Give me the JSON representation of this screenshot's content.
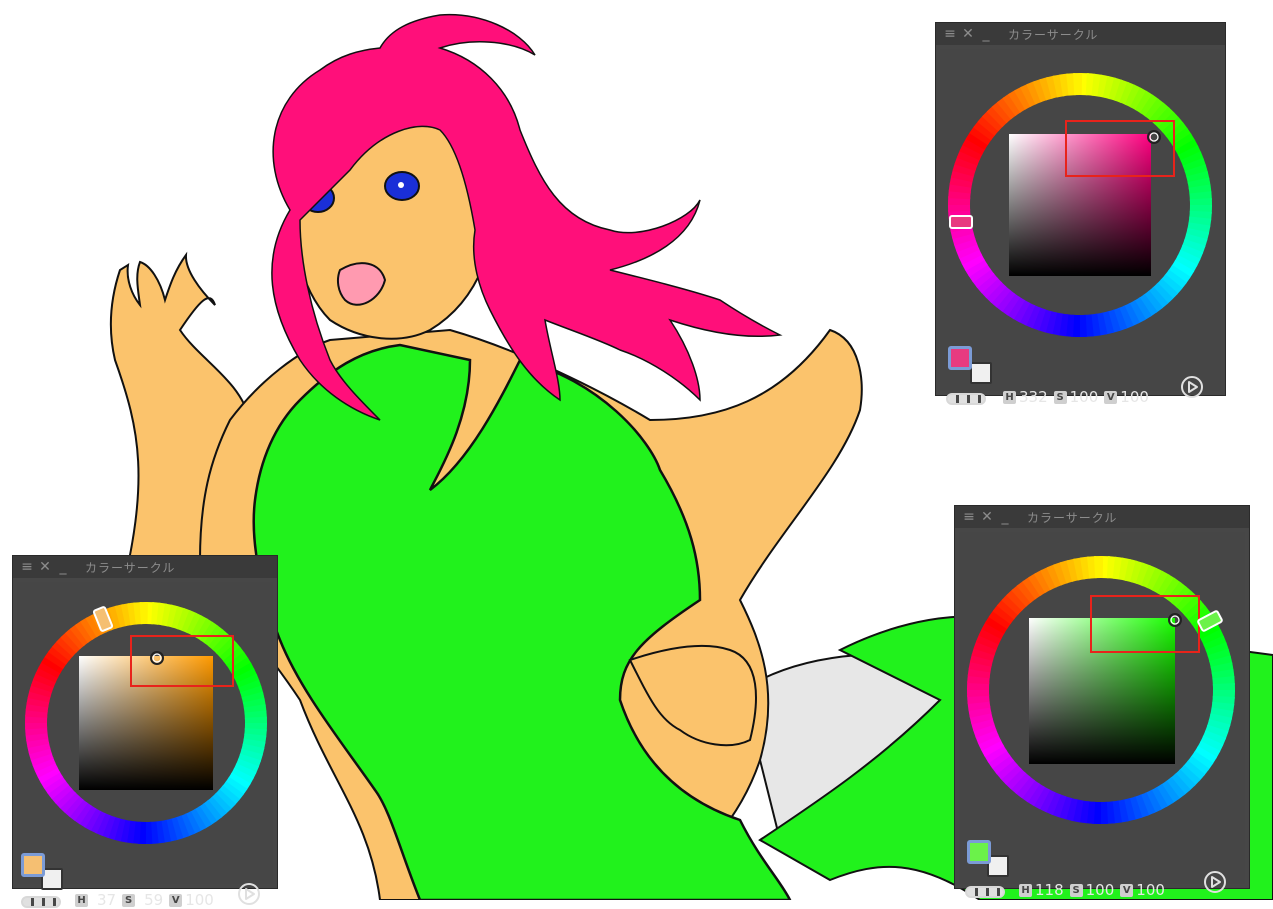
{
  "panels": [
    {
      "id": "top-right",
      "title": "カラーサークル",
      "hsv": {
        "h_label": "H",
        "h": "332",
        "s_label": "S",
        "s": "100",
        "v_label": "V",
        "v": "100"
      },
      "main_color": "#e83a80",
      "hue_marker_color": "#e83a80"
    },
    {
      "id": "bottom-left",
      "title": "カラーサークル",
      "hsv": {
        "h_label": "H",
        "h": "37",
        "s_label": "S",
        "s": "59",
        "v_label": "V",
        "v": "100"
      },
      "main_color": "#f5bf72",
      "hue_marker_color": "#f5bf72"
    },
    {
      "id": "bottom-right",
      "title": "カラーサークル",
      "hsv": {
        "h_label": "H",
        "h": "118",
        "s_label": "S",
        "s": "100",
        "v_label": "V",
        "v": "100"
      },
      "main_color": "#6bf24a",
      "hue_marker_color": "#6bf24a"
    }
  ],
  "icons": {
    "menu": "menu-icon",
    "close": "close-icon",
    "minimize": "minimize-icon",
    "play": "play-icon"
  },
  "colors": {
    "hair": "#ff0f7a",
    "skin": "#fbc36c",
    "dress": "#21f21c",
    "cloth": "#e7e7e7",
    "eyes": "#1a2fd8",
    "highlight_box": "#e8231b"
  }
}
